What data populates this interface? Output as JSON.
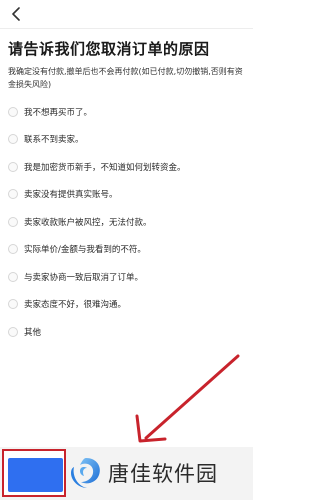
{
  "header": {
    "back_icon": "chevron-left-icon"
  },
  "title": "请告诉我们您取消订单的原因",
  "subtitle": "我确定没有付款,撤单后也不会再付款(如已付款,切勿撤销,否则有资金损失风险)",
  "reasons": [
    {
      "label": "我不想再买币了。"
    },
    {
      "label": "联系不到卖家。"
    },
    {
      "label": "我是加密货币新手，不知道如何划转资金。"
    },
    {
      "label": "卖家没有提供真实账号。"
    },
    {
      "label": "卖家收款账户被风控，无法付款。"
    },
    {
      "label": "实际单价/金额与我看到的不符。"
    },
    {
      "label": "与卖家协商一致后取消了订单。"
    },
    {
      "label": "卖家态度不好，很难沟通。"
    },
    {
      "label": "其他"
    }
  ],
  "colors": {
    "submit_button": "#2f6ff0",
    "highlight_frame": "#c8232c",
    "arrow": "#c8232c"
  },
  "watermark": {
    "text": "唐佳软件园",
    "logo_icon": "blue-swirl-logo"
  }
}
